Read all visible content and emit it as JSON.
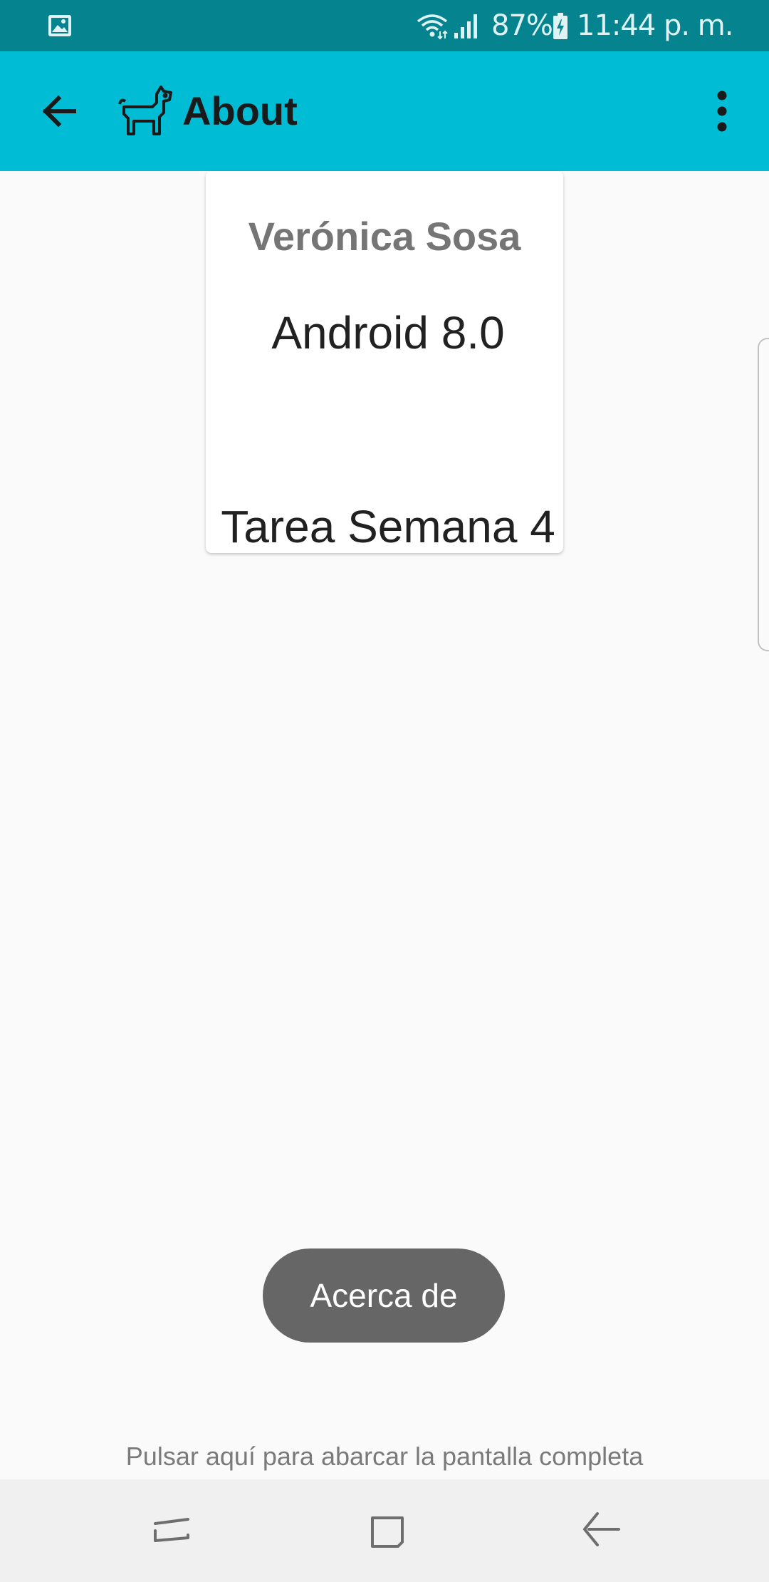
{
  "status_bar": {
    "battery_percent": "87%",
    "time": "11:44 p. m."
  },
  "app_bar": {
    "title": "About",
    "back_icon": "arrow-back-icon",
    "app_icon": "dog-icon",
    "overflow_icon": "more-vert-icon",
    "color": "#00bcd4"
  },
  "card": {
    "name": "Verónica Sosa",
    "version": "Android 8.0",
    "task": "Tarea Semana 4"
  },
  "toast": {
    "text": "Acerca de"
  },
  "fullscreen_hint": "Pulsar aquí para abarcar la pantalla completa",
  "nav_bar": {
    "items": [
      "recents-icon",
      "home-icon",
      "back-icon"
    ]
  },
  "colors": {
    "status_bar": "#05838f",
    "app_bar": "#00bcd4",
    "background": "#fafafa",
    "toast": "#666666"
  }
}
